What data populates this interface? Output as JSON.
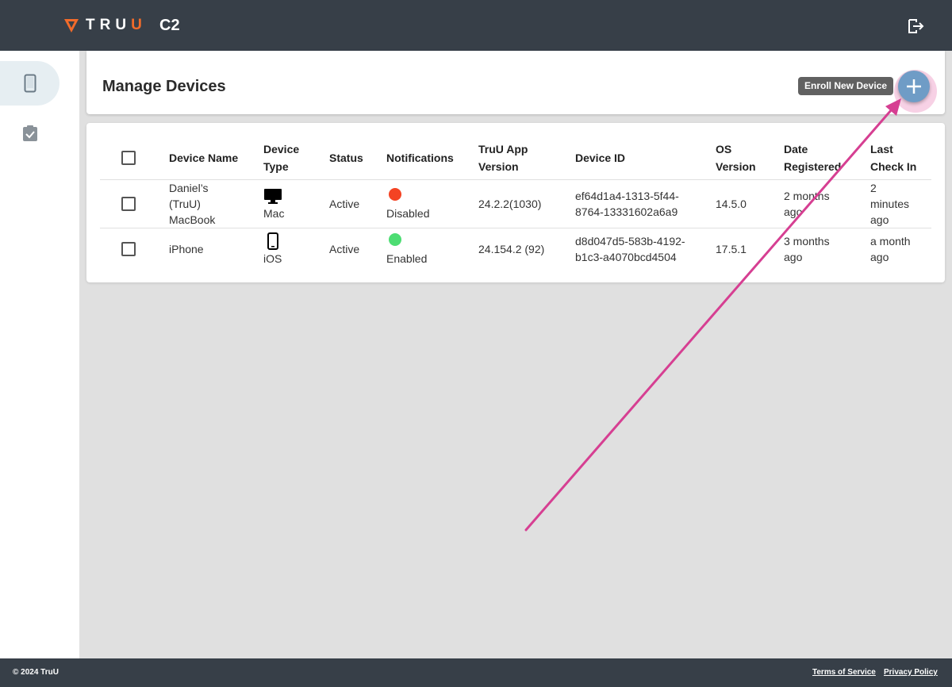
{
  "header": {
    "logo_text": "TRUU",
    "app_name": "C2",
    "brand_color": "#f26b2a",
    "logout_icon": "logout-icon"
  },
  "sidebar": {
    "items": [
      {
        "name": "devices",
        "icon": "smartphone-icon",
        "active": true
      },
      {
        "name": "assignments",
        "icon": "clipboard-check-icon",
        "active": false
      }
    ]
  },
  "page": {
    "title": "Manage Devices",
    "enroll_tooltip": "Enroll New Device",
    "fab_label": "+"
  },
  "table": {
    "headers": {
      "device_name": "Device Name",
      "device_type": [
        "Device",
        "Type"
      ],
      "status": "Status",
      "notifications": "Notifications",
      "app_version": [
        "TruU App",
        "Version"
      ],
      "device_id": "Device ID",
      "os_version": [
        "OS",
        "Version"
      ],
      "date_registered": [
        "Date",
        "Registered"
      ],
      "last_check_in": [
        "Last",
        "Check In"
      ]
    },
    "rows": [
      {
        "device_name": [
          "Daniel’s",
          "(TruU)",
          "MacBook"
        ],
        "device_type": "Mac",
        "device_icon": "desktop-icon",
        "status": "Active",
        "notifications": "Disabled",
        "notification_color": "#f44323",
        "app_version": "24.2.2(1030)",
        "device_id": [
          "ef64d1a4-1313-5f44-",
          "8764-13331602a6a9"
        ],
        "os_version": "14.5.0",
        "date_registered": [
          "2 months",
          "ago"
        ],
        "last_check_in": [
          "2",
          "minutes",
          "ago"
        ]
      },
      {
        "device_name": [
          "iPhone"
        ],
        "device_type": "iOS",
        "device_icon": "phone-icon",
        "status": "Active",
        "notifications": "Enabled",
        "notification_color": "#4ddd73",
        "app_version": "24.154.2 (92)",
        "device_id": [
          "d8d047d5-583b-4192-",
          "b1c3-a4070bcd4504"
        ],
        "os_version": "17.5.1",
        "date_registered": [
          "3 months",
          "ago"
        ],
        "last_check_in": [
          "a month",
          "ago"
        ]
      }
    ]
  },
  "footer": {
    "copyright": "© 2024 TruU",
    "terms": "Terms of Service",
    "privacy": "Privacy Policy"
  }
}
